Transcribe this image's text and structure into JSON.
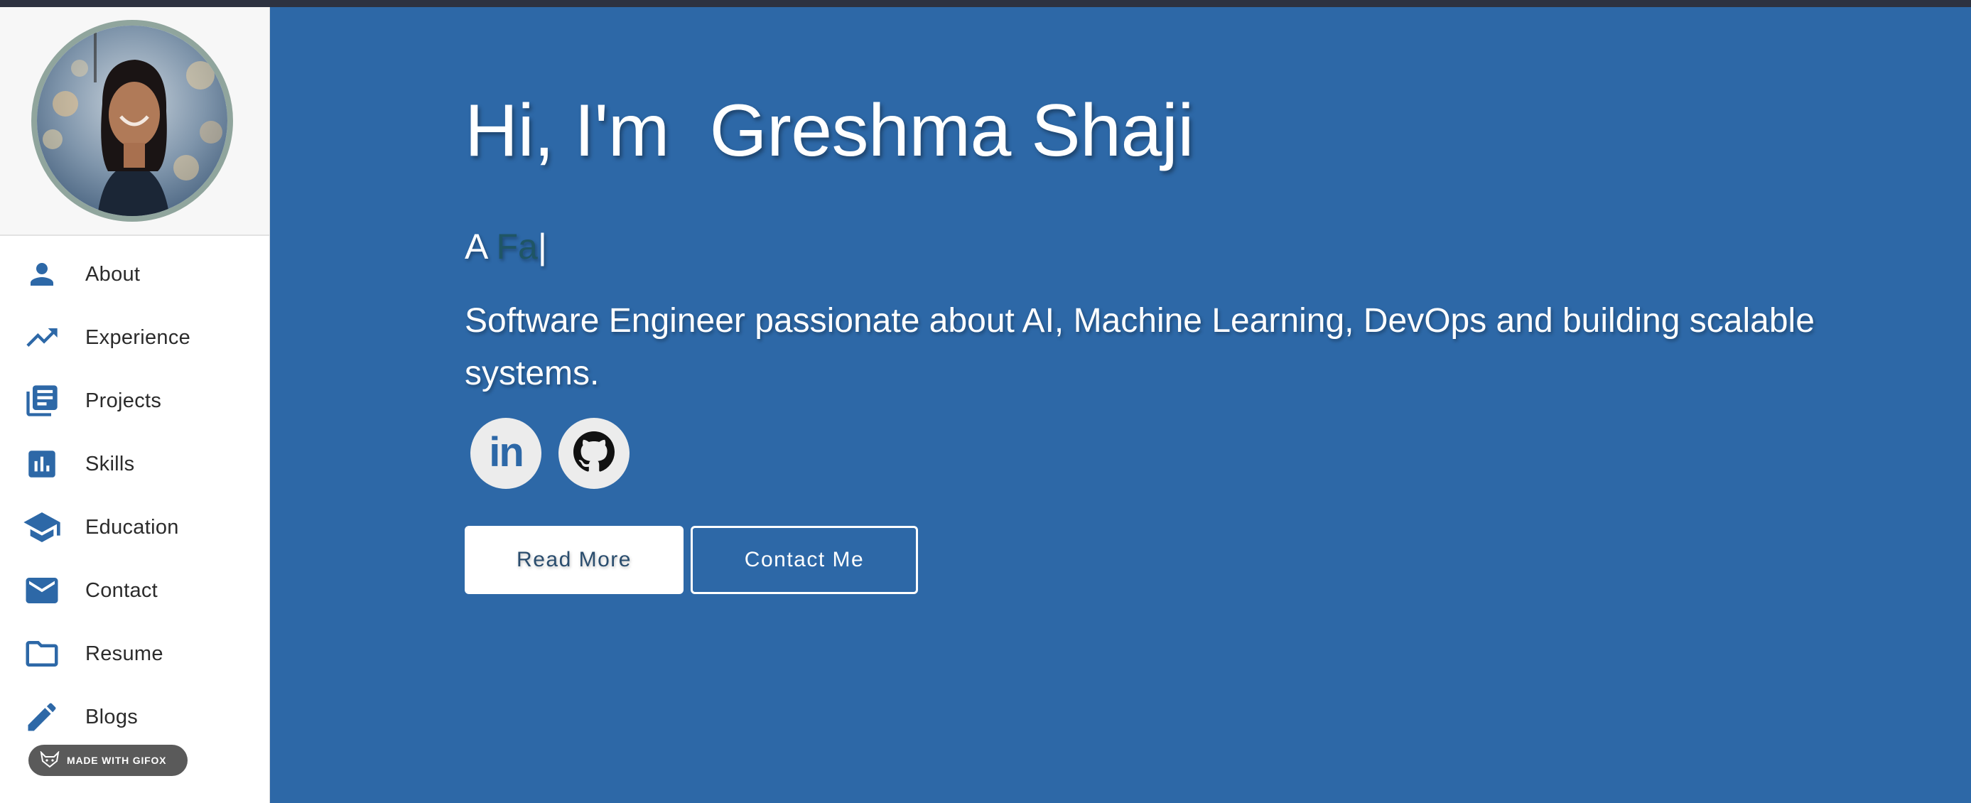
{
  "sidebar": {
    "items": [
      {
        "label": "About",
        "icon": "person-icon"
      },
      {
        "label": "Experience",
        "icon": "trending-up-icon"
      },
      {
        "label": "Projects",
        "icon": "library-books-icon"
      },
      {
        "label": "Skills",
        "icon": "bar-chart-icon"
      },
      {
        "label": "Education",
        "icon": "graduation-cap-icon"
      },
      {
        "label": "Contact",
        "icon": "mail-icon"
      },
      {
        "label": "Resume",
        "icon": "folder-icon"
      },
      {
        "label": "Blogs",
        "icon": "pencil-icon"
      }
    ],
    "badge": "MADE WITH GIFOX"
  },
  "hero": {
    "title": "Hi, I'm  Greshma Shaji",
    "typed_prefix": "A ",
    "typed_word": "Fa",
    "typed_cursor": "|",
    "description": "Software Engineer passionate about AI, Machine Learning, DevOps and building scalable systems.",
    "social": [
      {
        "name": "linkedin-icon",
        "text": "in"
      },
      {
        "name": "github-icon"
      }
    ],
    "buttons": {
      "read_more": "Read More",
      "contact_me": "Contact Me"
    }
  },
  "colors": {
    "main_bg": "#2d68a7",
    "sidebar_icon": "#2d68a7",
    "topbar": "#2d3240",
    "avatar_ring": "#90a59d"
  }
}
